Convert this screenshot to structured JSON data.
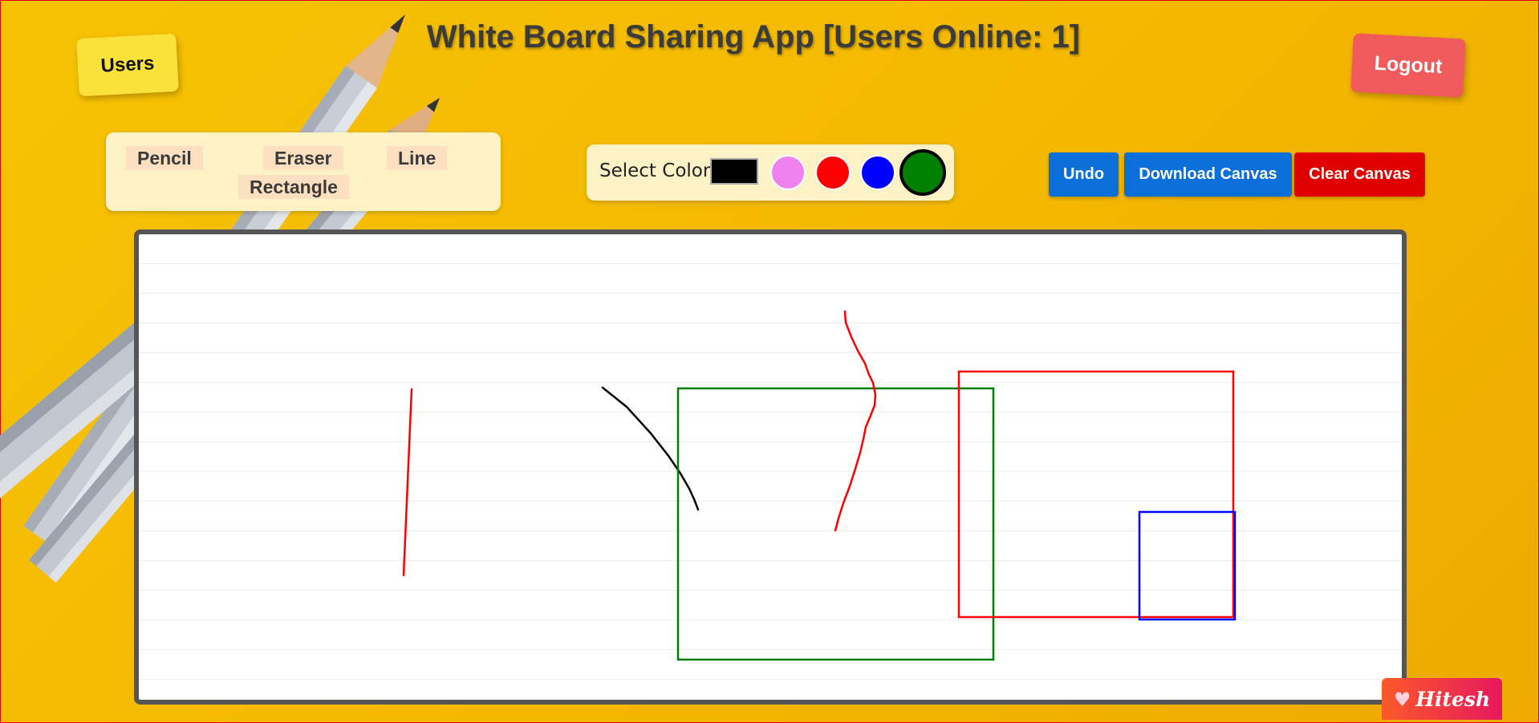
{
  "header": {
    "title": "White Board Sharing App [Users Online: 1]"
  },
  "users_button": {
    "label": "Users"
  },
  "logout_button": {
    "label": "Logout"
  },
  "tools": [
    {
      "label": "Pencil"
    },
    {
      "label": "Eraser"
    },
    {
      "label": "Line"
    },
    {
      "label": "Rectangle"
    }
  ],
  "color_picker": {
    "label": "Select Color",
    "current_color": "#000000",
    "swatches": [
      {
        "name": "violet",
        "color": "#ee82ee"
      },
      {
        "name": "red",
        "color": "#ff0000"
      },
      {
        "name": "blue",
        "color": "#0000ff"
      },
      {
        "name": "green",
        "color": "#008000",
        "selected": true
      }
    ]
  },
  "actions": {
    "undo": "Undo",
    "download": "Download Canvas",
    "clear": "Clear Canvas"
  },
  "canvas": {
    "strokes": [
      {
        "tool": "line",
        "color": "#ff0000"
      },
      {
        "tool": "pencil",
        "color": "#000000"
      },
      {
        "tool": "rectangle",
        "color": "#008000"
      },
      {
        "tool": "pencil",
        "color": "#ff0000"
      },
      {
        "tool": "rectangle",
        "color": "#ff0000"
      },
      {
        "tool": "rectangle",
        "color": "#0000ff"
      }
    ]
  },
  "badge": {
    "label": "Hitesh",
    "icon": "heart-icon"
  },
  "colors": {
    "background": "#f5b800",
    "users_button": "#fbe23a",
    "logout_button": "#f15a5a",
    "panel": "#fdf1c6",
    "tool_button": "#fde0c0",
    "undo": "#0a6fd8",
    "download": "#0a6fd8",
    "clear": "#e00000"
  }
}
